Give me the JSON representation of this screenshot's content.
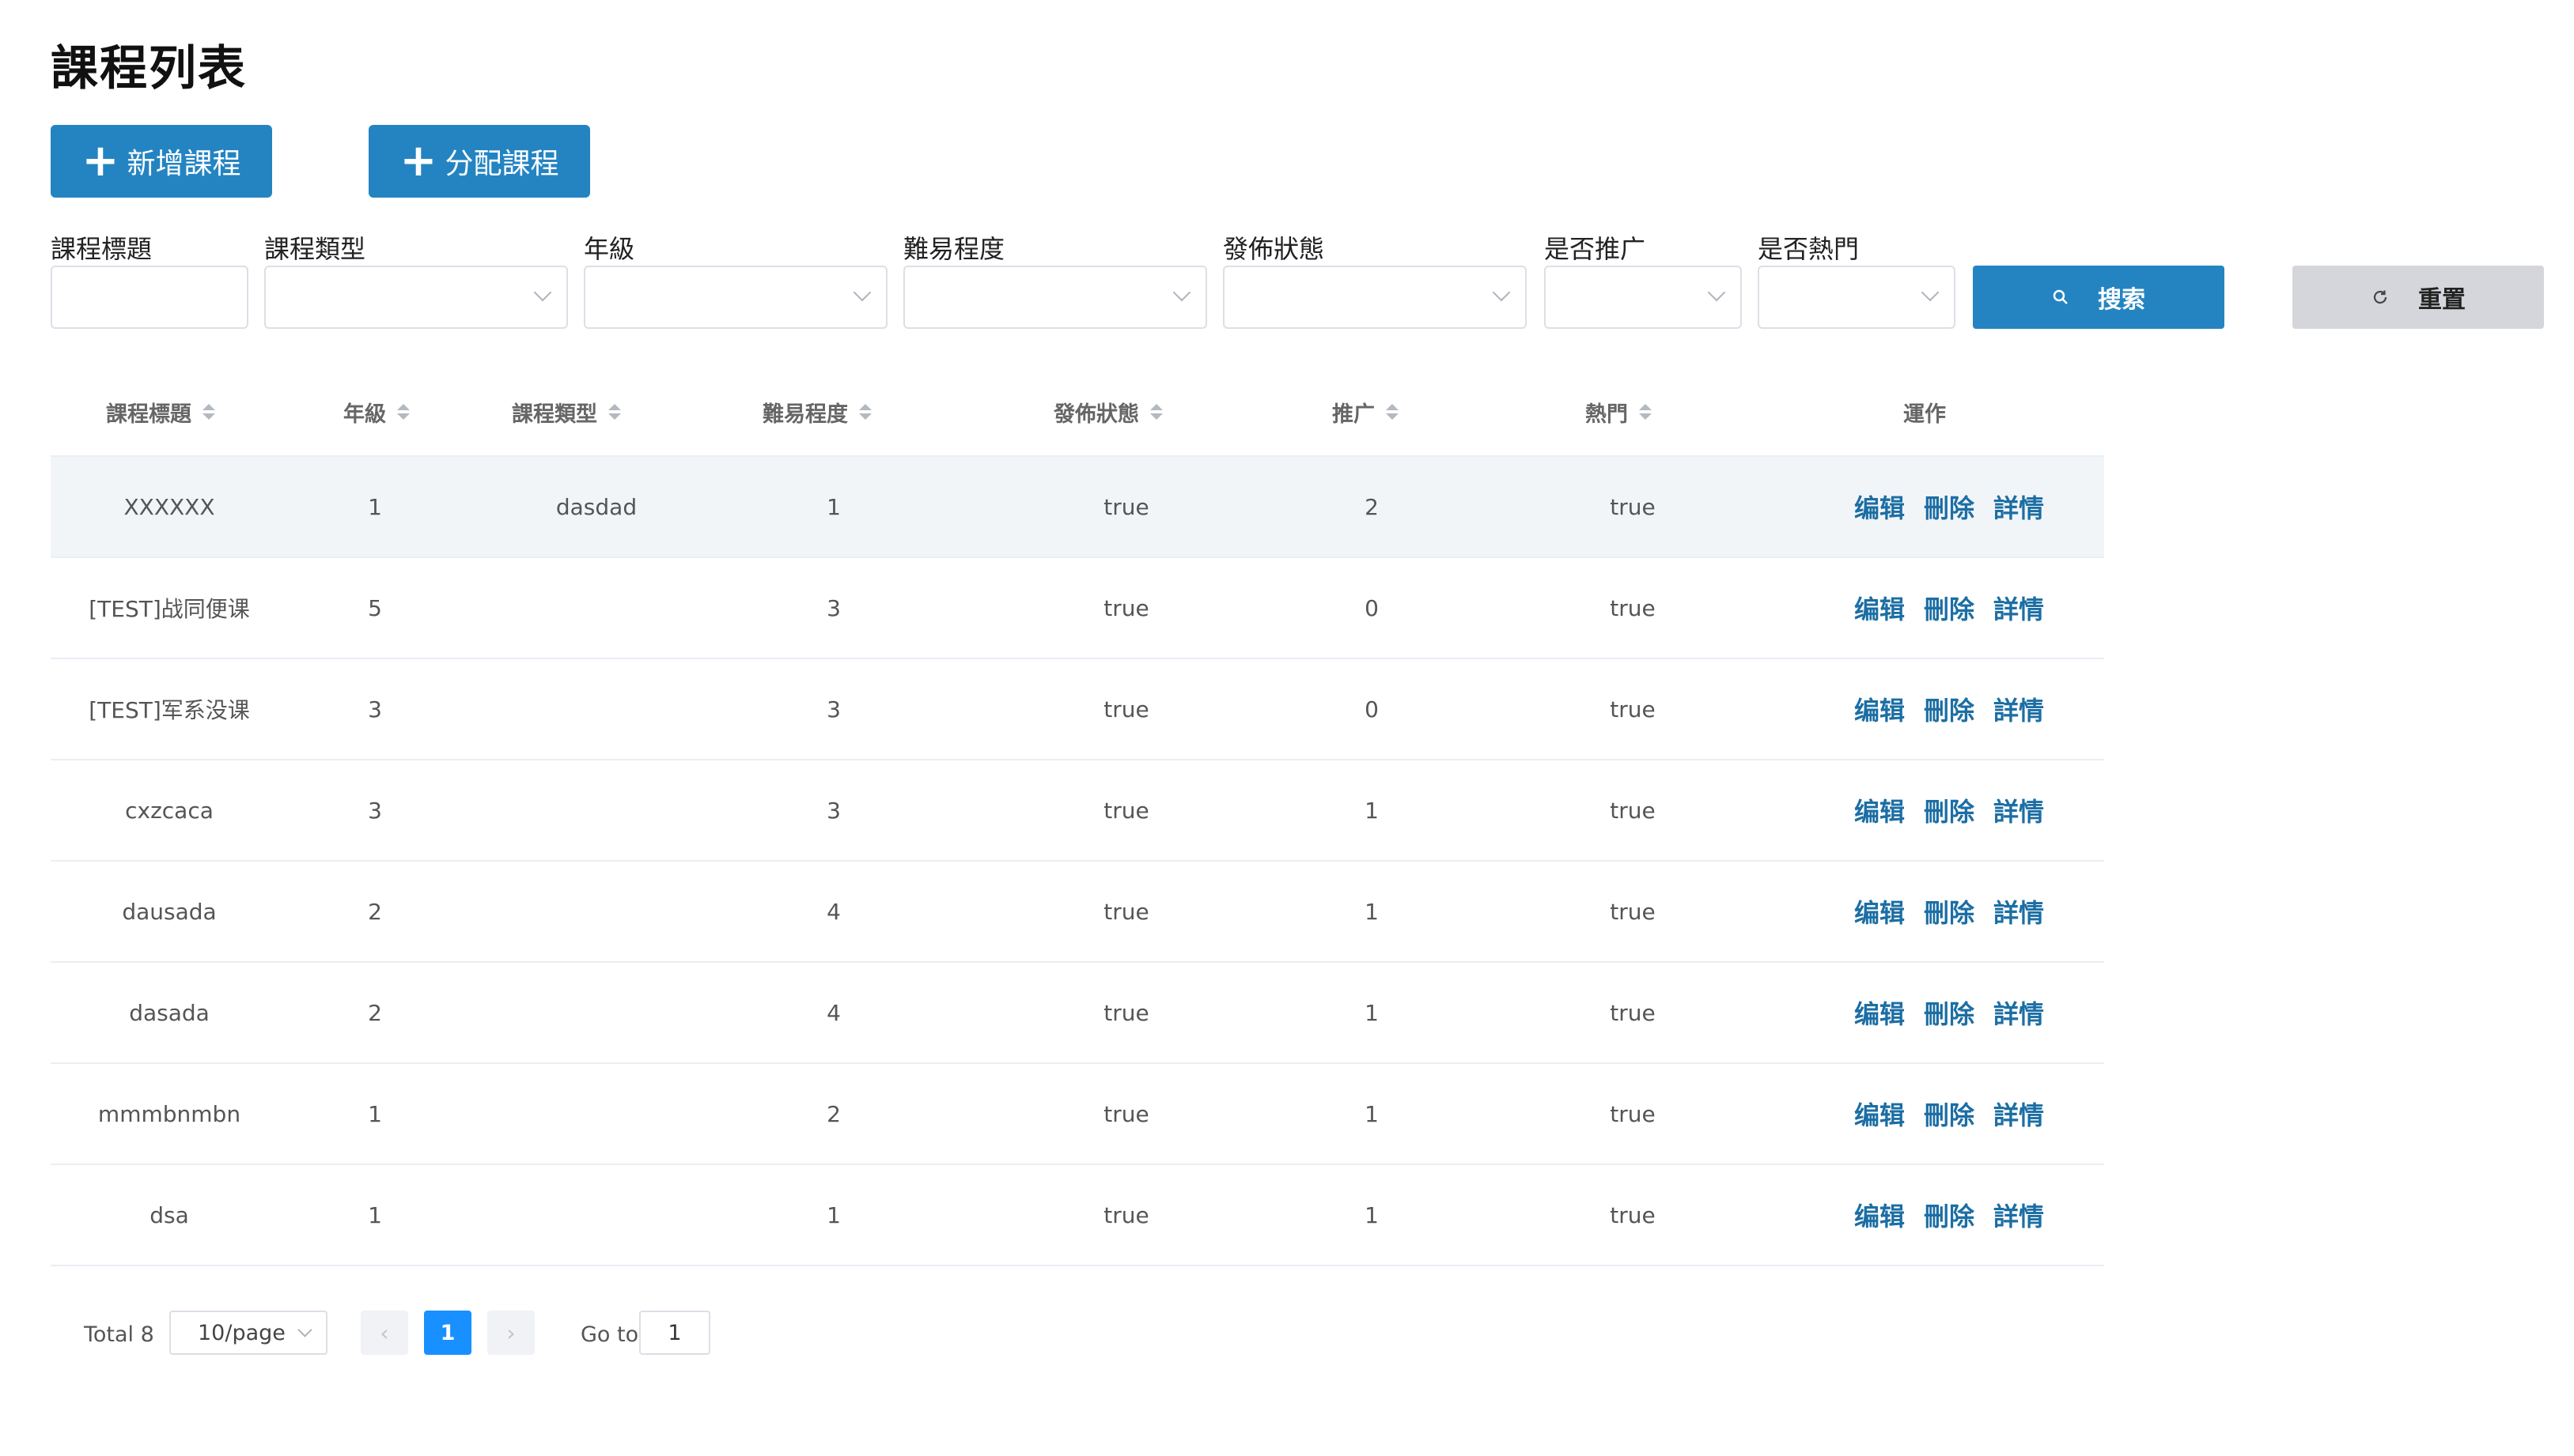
{
  "page": {
    "title": "課程列表"
  },
  "toolbar": {
    "add_label": "新增課程",
    "assign_label": "分配課程"
  },
  "filters": {
    "title_label": "課程標題",
    "type_label": "課程類型",
    "grade_label": "年級",
    "difficulty_label": "難易程度",
    "status_label": "發佈狀態",
    "promote_label": "是否推广",
    "hot_label": "是否熱門",
    "search_label": "搜索",
    "reset_label": "重置"
  },
  "table": {
    "headers": {
      "title": "課程標題",
      "grade": "年級",
      "type": "課程類型",
      "difficulty": "難易程度",
      "status": "發佈狀態",
      "promote": "推广",
      "hot": "熱門",
      "ops": "運作"
    },
    "actions": {
      "edit": "编辑",
      "delete": "刪除",
      "detail": "詳情"
    },
    "rows": [
      {
        "title": "XXXXXX",
        "grade": "1",
        "type": "dasdad",
        "difficulty": "1",
        "status": "true",
        "promote": "2",
        "hot": "true"
      },
      {
        "title": "[TEST]战同便课",
        "grade": "5",
        "type": "",
        "difficulty": "3",
        "status": "true",
        "promote": "0",
        "hot": "true"
      },
      {
        "title": "[TEST]军系没课",
        "grade": "3",
        "type": "",
        "difficulty": "3",
        "status": "true",
        "promote": "0",
        "hot": "true"
      },
      {
        "title": "cxzcaca",
        "grade": "3",
        "type": "",
        "difficulty": "3",
        "status": "true",
        "promote": "1",
        "hot": "true"
      },
      {
        "title": "dausada",
        "grade": "2",
        "type": "",
        "difficulty": "4",
        "status": "true",
        "promote": "1",
        "hot": "true"
      },
      {
        "title": "dasada",
        "grade": "2",
        "type": "",
        "difficulty": "4",
        "status": "true",
        "promote": "1",
        "hot": "true"
      },
      {
        "title": "mmmbnmbn",
        "grade": "1",
        "type": "",
        "difficulty": "2",
        "status": "true",
        "promote": "1",
        "hot": "true"
      },
      {
        "title": "dsa",
        "grade": "1",
        "type": "",
        "difficulty": "1",
        "status": "true",
        "promote": "1",
        "hot": "true"
      }
    ]
  },
  "pagination": {
    "total_label": "Total 8",
    "page_size": "10/page",
    "current_page": "1",
    "goto_label": "Go to",
    "goto_value": "1",
    "prev_symbol": "‹",
    "next_symbol": "›"
  }
}
